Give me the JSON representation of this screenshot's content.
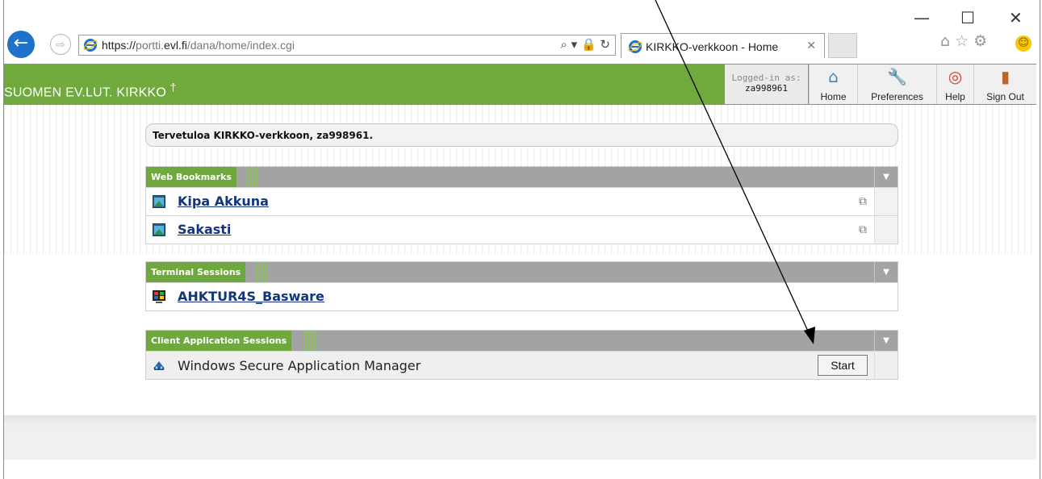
{
  "window": {
    "minimize": "—",
    "maximize": "☐",
    "close": "✕"
  },
  "browser": {
    "url_scheme": "https://",
    "url_domain_prefix": "portti.",
    "url_domain": "evl.fi",
    "url_path": "/dana/home/index.cgi",
    "address_controls": "⌕ ▾ 🔒 ↻",
    "tab_title": "KIRKKO-verkkoon - Home",
    "tab_close": "✕",
    "tools": "⌂☆⚙"
  },
  "header": {
    "brand": "SUOMEN EV.LUT. KIRKKO",
    "brand_cross": "†",
    "logged_label": "Logged-in as:",
    "username": "za998961",
    "nav": [
      {
        "label": "Home",
        "icon": "⌂",
        "icon_name": "home-icon"
      },
      {
        "label": "Preferences",
        "icon": "🔧",
        "icon_name": "wrench-icon"
      },
      {
        "label": "Help",
        "icon": "◎",
        "icon_name": "lifebuoy-icon"
      },
      {
        "label": "Sign Out",
        "icon": "▮",
        "icon_name": "door-icon"
      }
    ]
  },
  "welcome": "Tervetuloa KIRKKO-verkkoon, za998961.",
  "panels": {
    "web_bookmarks": {
      "title": "Web Bookmarks",
      "items": [
        {
          "label": "Kipa Akkuna"
        },
        {
          "label": "Sakasti"
        }
      ]
    },
    "terminal_sessions": {
      "title": "Terminal Sessions",
      "items": [
        {
          "label": "AHKTUR4S_Basware"
        }
      ]
    },
    "client_sessions": {
      "title": "Client Application Sessions",
      "items": [
        {
          "label": "Windows Secure Application Manager",
          "button": "Start"
        }
      ]
    }
  },
  "colors": {
    "brand_green": "#71aa3c",
    "panel_gray": "#a3a3a3",
    "link_blue": "#13357f",
    "ie_blue": "#1e72c9"
  }
}
